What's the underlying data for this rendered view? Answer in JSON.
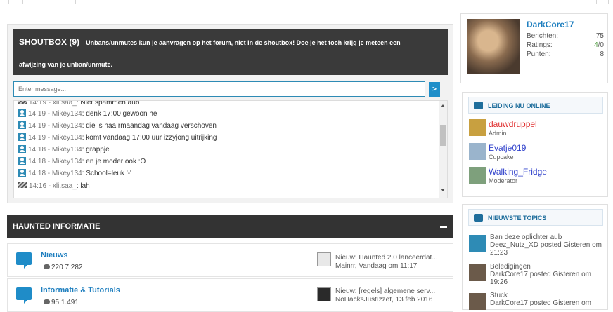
{
  "shoutbox": {
    "title": "SHOUTBOX (9)",
    "notice_line1": "Unbans/unmutes kun je aanvragen op het forum, niet in de shoutbox! Doe je het toch krijg je meteen een",
    "notice_line2": "afwijzing van je unban/unmute.",
    "input_placeholder": "Enter message...",
    "send_label": ">",
    "messages": [
      {
        "time": "14:19 - xli.saa_",
        "text": ": Niet spammen aub",
        "icon": "user-alt-icon"
      },
      {
        "time": "14:19 - Mikey134",
        "text": ": denk 17:00 gewoon he",
        "icon": "user-icon"
      },
      {
        "time": "14:19 - Mikey134",
        "text": ": die is naa rmaandag vandaag verschoven",
        "icon": "user-icon"
      },
      {
        "time": "14:19 - Mikey134",
        "text": ": komt vandaag 17:00 uur izzyjong uitrijking",
        "icon": "user-icon"
      },
      {
        "time": "14:18 - Mikey134",
        "text": ": grappje",
        "icon": "user-icon"
      },
      {
        "time": "14:18 - Mikey134",
        "text": ": en je moder ook :O",
        "icon": "user-icon"
      },
      {
        "time": "14:18 - Mikey134",
        "text": ": School=leuk '-'",
        "icon": "user-icon"
      },
      {
        "time": "14:16 - xli.saa_",
        "text": ": lah",
        "icon": "user-alt-icon"
      }
    ]
  },
  "haunted": {
    "title": "HAUNTED INFORMATIE",
    "forums": [
      {
        "name": "Nieuws",
        "stats": "220  7.282",
        "last_line1": "Nieuw: Haunted 2.0 lanceerdat...",
        "last_line2": "Mainrr, Vandaag om 11:17"
      },
      {
        "name": "Informatie & Tutorials",
        "stats": "95  1.491",
        "last_line1": "Nieuw: [regels] algemene serv...",
        "last_line2": "NoHacksJustIzzet, 13 feb 2016"
      }
    ]
  },
  "profile": {
    "name": "DarkCore17",
    "berichten_label": "Berichten:",
    "berichten": "75",
    "ratings_label": "Ratings:",
    "ratings_pos": "4",
    "ratings_neg": "/0",
    "punten_label": "Punten:",
    "punten": "8"
  },
  "staff_box": {
    "title": "LEIDING NU ONLINE",
    "members": [
      {
        "name": "dauwdruppel",
        "role": "Admin",
        "color": "#e03030"
      },
      {
        "name": "Evatje019",
        "role": "Cupcake",
        "color": "#3344cc"
      },
      {
        "name": "Walking_Fridge",
        "role": "Moderator",
        "color": "#3344cc"
      }
    ]
  },
  "topics_box": {
    "title": "NIEUWSTE TOPICS",
    "topics": [
      {
        "title": "Ban deze oplichter aub",
        "meta": "Deez_Nutz_XD posted Gisteren om 21:23"
      },
      {
        "title": "Beledigingen",
        "meta": "DarkCore17 posted Gisteren om 19:26"
      },
      {
        "title": "Stuck",
        "meta": "DarkCore17 posted Gisteren om"
      }
    ]
  }
}
